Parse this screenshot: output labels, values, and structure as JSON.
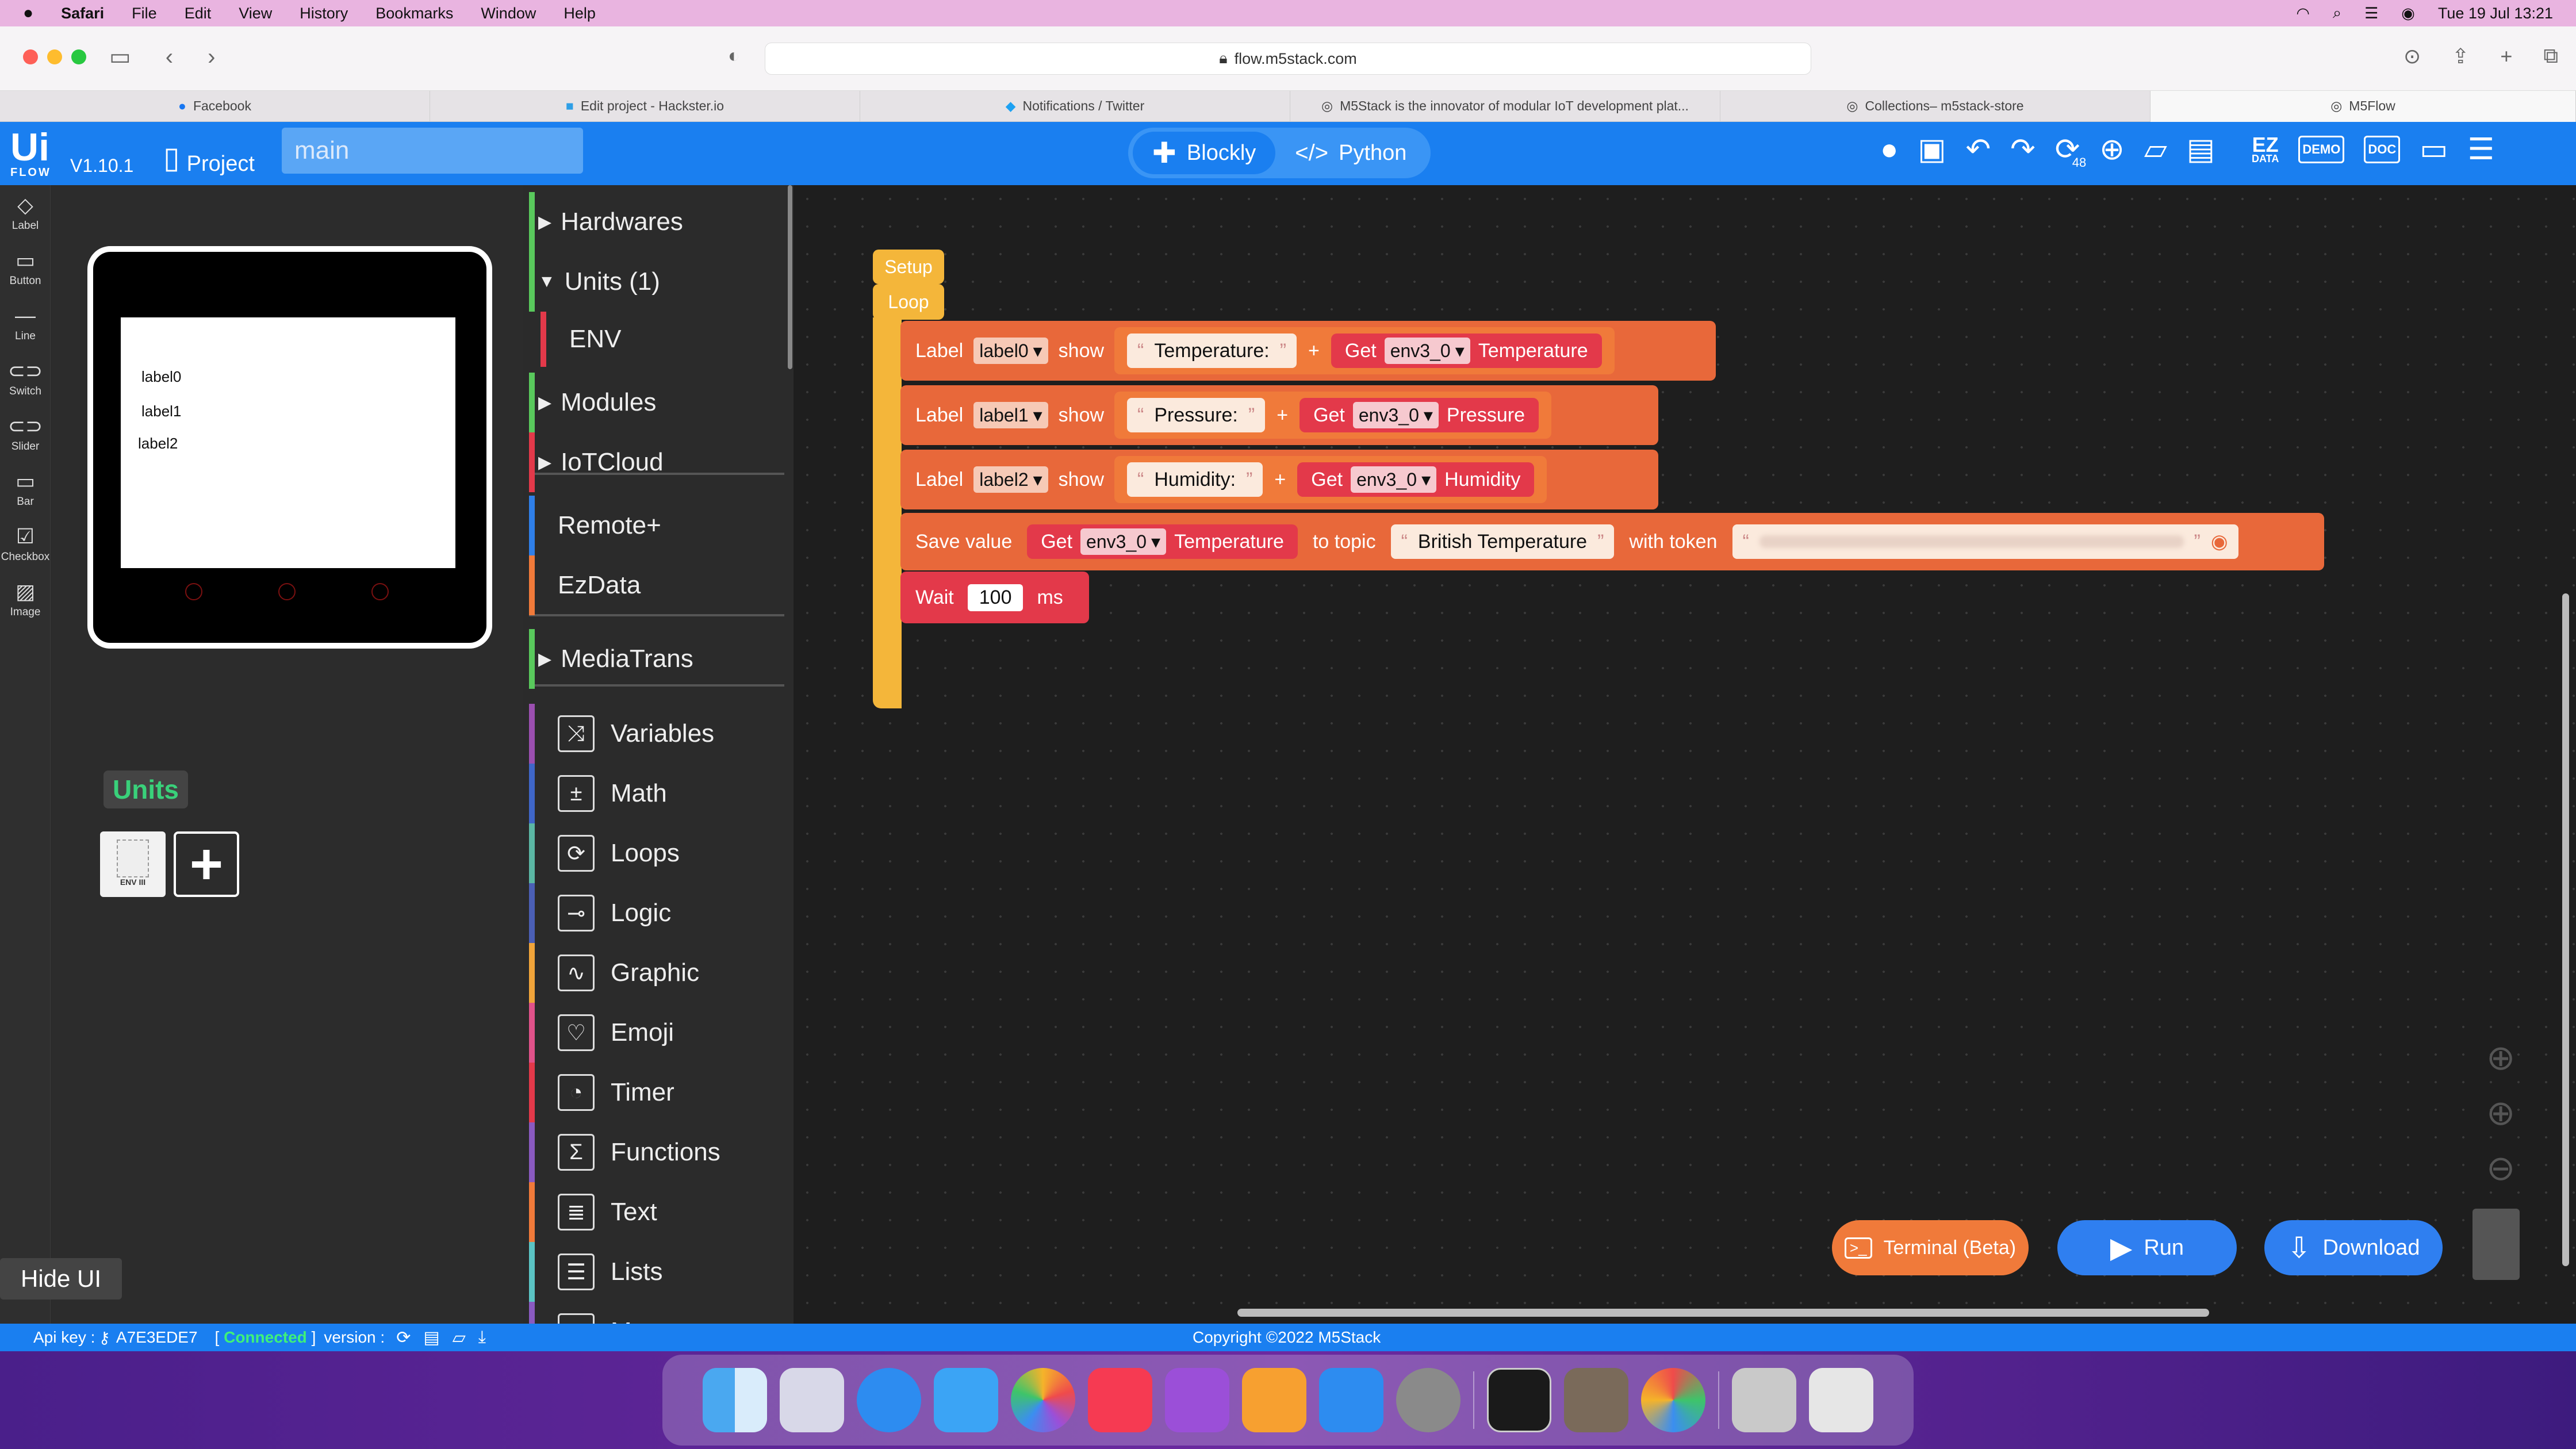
{
  "menubar": {
    "app": "Safari",
    "items": [
      "File",
      "Edit",
      "View",
      "History",
      "Bookmarks",
      "Window",
      "Help"
    ],
    "datetime": "Tue 19 Jul  13:21"
  },
  "browser": {
    "url": "flow.m5stack.com",
    "tabs": [
      "Facebook",
      "Edit project - Hackster.io",
      "Notifications / Twitter",
      "M5Stack is the innovator of modular IoT development plat...",
      "Collections– m5stack-store",
      "M5Flow"
    ]
  },
  "header": {
    "logo_top": "Ui",
    "logo_bottom": "FLOW",
    "version": "V1.10.1",
    "project_label": "Project",
    "project_name": "main",
    "tab_blockly": "Blockly",
    "tab_python": "Python",
    "refresh_badge": "48",
    "ez_top": "EZ",
    "ez_bottom": "DATA",
    "demo": "DEMO",
    "doc": "DOC"
  },
  "leftbar": {
    "items": [
      "Label",
      "Button",
      "Line",
      "Switch",
      "Slider",
      "Bar",
      "Checkbox",
      "Image"
    ]
  },
  "device": {
    "labels": [
      "label0",
      "label1",
      "label2"
    ]
  },
  "units_panel": {
    "title": "Units",
    "unit_caption": "ENV III",
    "hide_ui": "Hide UI"
  },
  "palette": {
    "items": [
      {
        "label": "Hardwares",
        "arrow": "▶",
        "color": "#59c95c"
      },
      {
        "label": "Units (1)",
        "arrow": "▼",
        "color": "#59c95c"
      },
      {
        "label": "ENV",
        "arrow": "",
        "color": "#e3394a"
      },
      {
        "label": "Modules",
        "arrow": "▶",
        "color": "#59c95c"
      },
      {
        "label": "IoTCloud",
        "arrow": "▶",
        "color": "#e3394a"
      },
      {
        "label": "Remote+",
        "arrow": "",
        "color": "#2f7fe8"
      },
      {
        "label": "EzData",
        "arrow": "",
        "color": "#f07a3a"
      },
      {
        "label": "MediaTrans",
        "arrow": "▶",
        "color": "#59c95c"
      },
      {
        "label": "Variables",
        "arrow": "",
        "color": "#9b4fb0"
      },
      {
        "label": "Math",
        "arrow": "",
        "color": "#3f66c8"
      },
      {
        "label": "Loops",
        "arrow": "",
        "color": "#5bb7a4"
      },
      {
        "label": "Logic",
        "arrow": "",
        "color": "#4b5fb5"
      },
      {
        "label": "Graphic",
        "arrow": "",
        "color": "#f0a43a"
      },
      {
        "label": "Emoji",
        "arrow": "",
        "color": "#e0528a"
      },
      {
        "label": "Timer",
        "arrow": "",
        "color": "#e3394a"
      },
      {
        "label": "Functions",
        "arrow": "",
        "color": "#8a5ac0"
      },
      {
        "label": "Text",
        "arrow": "",
        "color": "#f07a3a"
      },
      {
        "label": "Lists",
        "arrow": "",
        "color": "#5bc4c4"
      },
      {
        "label": "Map",
        "arrow": "",
        "color": "#8a5ac0"
      }
    ]
  },
  "blocks": {
    "setup": "Setup",
    "loop": "Loop",
    "label_kw": "Label",
    "show_kw": "show",
    "get_kw": "Get",
    "plus": "+",
    "sensor": "env3_0",
    "rows": [
      {
        "label": "label0",
        "text": "Temperature:",
        "field": "Temperature"
      },
      {
        "label": "label1",
        "text": "Pressure:",
        "field": "Pressure"
      },
      {
        "label": "label2",
        "text": "Humidity:",
        "field": "Humidity"
      }
    ],
    "save_value": "Save value",
    "save_field": "Temperature",
    "to_topic": "to topic",
    "topic": "British Temperature",
    "with_token": "with token",
    "wait_kw": "Wait",
    "wait_value": "100",
    "wait_unit": "ms"
  },
  "actions": {
    "terminal": "Terminal (Beta)",
    "run": "Run",
    "download": "Download"
  },
  "status": {
    "api_key_label": "Api key :",
    "api_key": "A7E3EDE7",
    "connected": "Connected",
    "version_label": "version :",
    "copyright": "Copyright ©2022 M5Stack"
  }
}
